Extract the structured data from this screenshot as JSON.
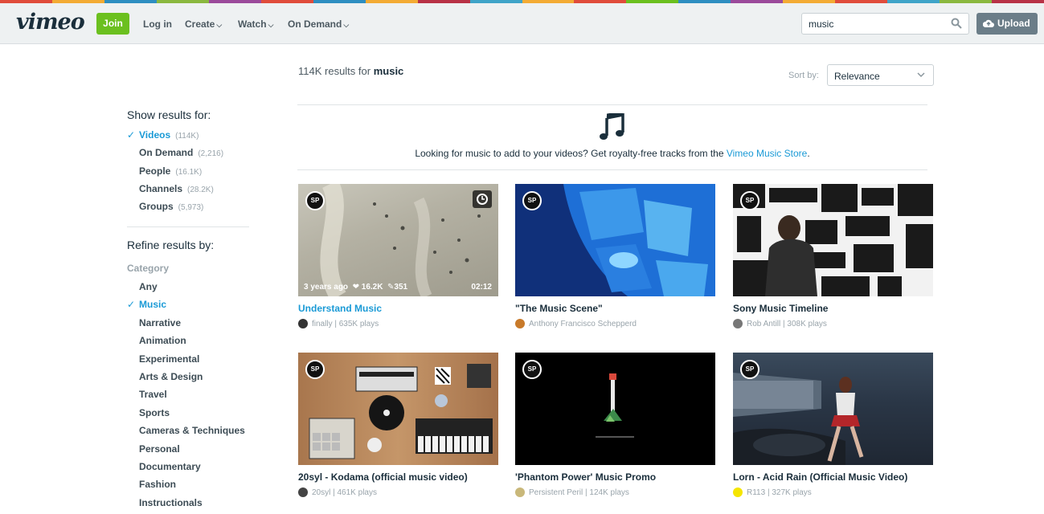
{
  "colors": {
    "accent": "#1a9ad6",
    "join_green": "#6bc01f",
    "upload_gray": "#6b7d88",
    "stripe": [
      "#e04c3b",
      "#f3ab34",
      "#2e8ec1",
      "#8ab83f",
      "#9b4a9b",
      "#e04c3b",
      "#2e8ec1",
      "#f3ab34",
      "#b83246",
      "#3fa4c8",
      "#f3ab34",
      "#e04c3b",
      "#6bc01f",
      "#2e8ec1",
      "#9b4a9b",
      "#f3ab34",
      "#e04c3b",
      "#3fa4c8",
      "#8ab83f",
      "#b83246"
    ]
  },
  "header": {
    "logo": "vimeo",
    "join_label": "Join",
    "login_label": "Log in",
    "create_label": "Create",
    "watch_label": "Watch",
    "ondemand_label": "On Demand",
    "search_value": "music",
    "upload_label": "Upload"
  },
  "results": {
    "count": "114K results for",
    "query": "music",
    "sort_label": "Sort by:",
    "sort_value": "Relevance"
  },
  "banner": {
    "text": "Looking for music to add to your videos? Get royalty-free tracks from the",
    "link": "Vimeo Music Store",
    "suffix": "."
  },
  "sidebar": {
    "show_heading": "Show results for:",
    "show_items": [
      {
        "label": "Videos",
        "count": "(114K)"
      },
      {
        "label": "On Demand",
        "count": "(2,216)"
      },
      {
        "label": "People",
        "count": "(16.1K)"
      },
      {
        "label": "Channels",
        "count": "(28.2K)"
      },
      {
        "label": "Groups",
        "count": "(5,973)"
      }
    ],
    "refine_heading": "Refine results by:",
    "category_label": "Category",
    "categories": [
      "Any",
      "Music",
      "Narrative",
      "Animation",
      "Experimental",
      "Arts & Design",
      "Travel",
      "Sports",
      "Cameras & Techniques",
      "Personal",
      "Documentary",
      "Fashion",
      "Instructionals"
    ]
  },
  "videos": [
    {
      "title": "Understand Music",
      "byline": "finally | 635K plays",
      "age": "3 years ago",
      "likes": "16.2K",
      "comments": "351",
      "duration": "02:12"
    },
    {
      "title": "\"The Music Scene\"",
      "byline": "Anthony Francisco Schepperd"
    },
    {
      "title": "Sony Music Timeline",
      "byline": "Rob Antill | 308K plays"
    },
    {
      "title": "20syl - Kodama (official music video)",
      "byline": "20syl | 461K plays"
    },
    {
      "title": "'Phantom Power' Music Promo",
      "byline": "Persistent Peril | 124K plays"
    },
    {
      "title": "Lorn - Acid Rain (Official Music Video)",
      "byline": "R113 | 327K plays"
    }
  ],
  "badge": "SP",
  "icons": [
    "search-icon",
    "cloud-upload-icon",
    "chevron-down-icon",
    "music-note-icon",
    "clock-icon",
    "heart-icon",
    "comment-icon",
    "check-icon"
  ]
}
